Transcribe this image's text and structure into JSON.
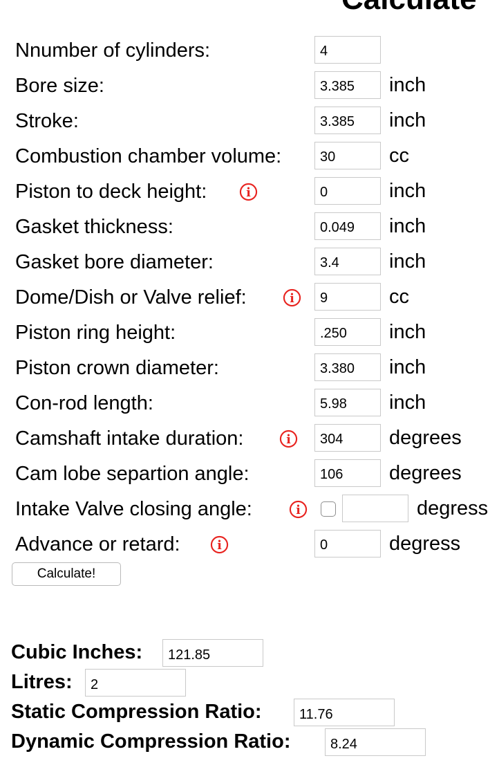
{
  "page": {
    "title": "Calculate"
  },
  "form": {
    "rows": [
      {
        "label": "Nnumber of cylinders:",
        "value": "4",
        "unit": ""
      },
      {
        "label": "Bore size:",
        "value": "3.385",
        "unit": "inch"
      },
      {
        "label": "Stroke:",
        "value": "3.385",
        "unit": "inch"
      },
      {
        "label": "Combustion chamber volume:",
        "value": "30",
        "unit": "cc"
      },
      {
        "label": "Piston to deck height:",
        "value": "0",
        "unit": "inch",
        "info_icon": "info-icon"
      },
      {
        "label": "Gasket thickness:",
        "value": "0.049",
        "unit": "inch"
      },
      {
        "label": "Gasket bore diameter:",
        "value": "3.4",
        "unit": "inch"
      },
      {
        "label": "Dome/Dish or Valve relief:",
        "value": "9",
        "unit": "cc",
        "info_icon": "info-icon"
      },
      {
        "label": "Piston ring height:",
        "value": ".250",
        "unit": "inch"
      },
      {
        "label": "Piston crown diameter:",
        "value": "3.380",
        "unit": "inch"
      },
      {
        "label": "Con-rod length:",
        "value": "5.98",
        "unit": "inch"
      },
      {
        "label": "Camshaft intake duration:",
        "value": "304",
        "unit": "degrees",
        "info_icon": "info-icon"
      },
      {
        "label": "Cam lobe separtion angle:",
        "value": "106",
        "unit": "degrees"
      },
      {
        "label": "Intake Valve closing angle:",
        "value": "",
        "unit": "degress",
        "info_icon": "info-icon",
        "checkbox_checked": false
      },
      {
        "label": "Advance or retard:",
        "value": "0",
        "unit": "degress",
        "info_icon": "info-icon"
      }
    ],
    "calculate_label": "Calculate!"
  },
  "results": [
    {
      "label": "Cubic Inches:",
      "value": "121.85"
    },
    {
      "label": "Litres:",
      "value": "2"
    },
    {
      "label": "Static Compression Ratio:",
      "value": "11.76"
    },
    {
      "label": "Dynamic Compression Ratio:",
      "value": "8.24"
    }
  ],
  "colors": {
    "info_icon": "#e8231f",
    "input_border": "#c9c9c9"
  }
}
